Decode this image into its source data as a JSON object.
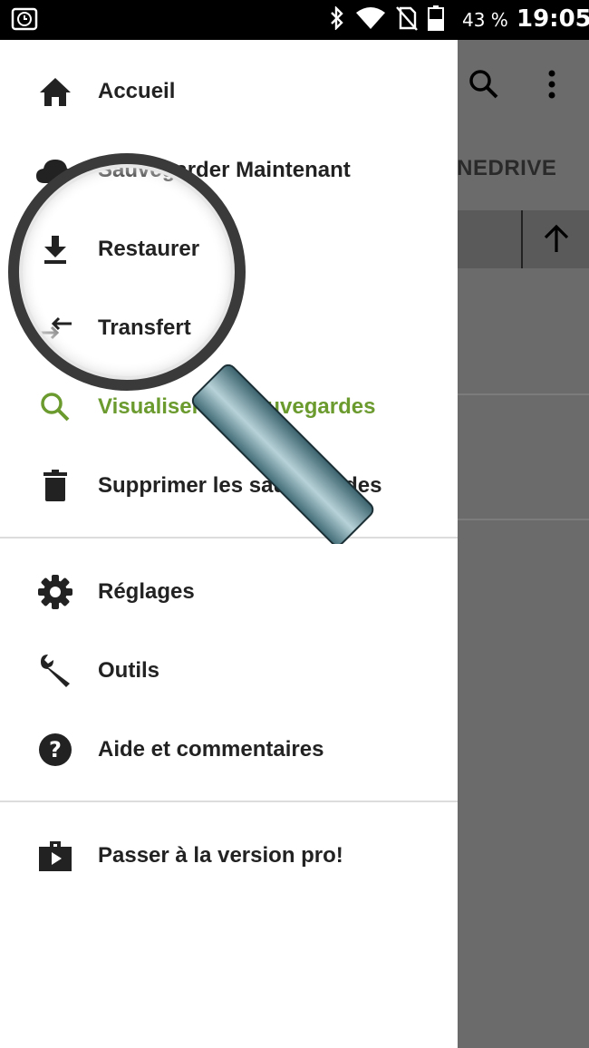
{
  "status_bar": {
    "battery_percent": "43 %",
    "time": "19:05",
    "icons": [
      "alarm-icon",
      "bluetooth-icon",
      "wifi-icon",
      "no-sim-icon",
      "battery-icon"
    ]
  },
  "background_app": {
    "tab_label": "ONEDRIVE",
    "toolbar_icons": [
      "search-icon",
      "more-vert-icon"
    ]
  },
  "drawer": {
    "section1": [
      {
        "label": "Accueil",
        "icon": "home-icon"
      },
      {
        "label": "Sauvegarder Maintenant",
        "icon": "cloud-icon"
      },
      {
        "label": "Restaurer",
        "icon": "download-icon"
      },
      {
        "label": "Transfert",
        "icon": "transfer-icon"
      },
      {
        "label": "Visualiser les sauvegardes",
        "icon": "search-icon",
        "active": true
      },
      {
        "label": "Supprimer les sauvegardes",
        "icon": "trash-icon"
      }
    ],
    "section2": [
      {
        "label": "Réglages",
        "icon": "gear-icon"
      },
      {
        "label": "Outils",
        "icon": "wrench-icon"
      },
      {
        "label": "Aide et commentaires",
        "icon": "help-icon"
      }
    ],
    "section3": [
      {
        "label": "Passer à la version pro!",
        "icon": "pro-store-icon"
      }
    ]
  },
  "colors": {
    "active": "#6b9a2e",
    "text": "#222222",
    "scrim": "#6f6f6f"
  }
}
